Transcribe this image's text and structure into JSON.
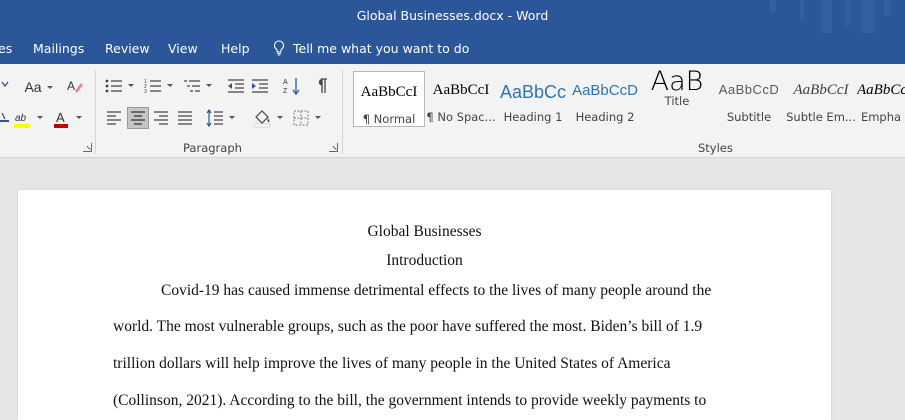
{
  "window": {
    "title": "Global Businesses.docx  -  Word"
  },
  "tabs": [
    "es",
    "Mailings",
    "Review",
    "View",
    "Help"
  ],
  "tell_me": "Tell me what you want to do",
  "ribbon": {
    "font_group": {
      "change_case_label": "Aa"
    },
    "paragraph_group": {
      "label": "Paragraph"
    },
    "styles_group": {
      "label": "Styles",
      "styles": [
        {
          "preview": "AaBbCcI",
          "name": "¶ Normal",
          "color": "#000000",
          "selected": true
        },
        {
          "preview": "AaBbCcI",
          "name": "¶ No Spac...",
          "color": "#000000"
        },
        {
          "preview": "AaBbCc",
          "name": "Heading 1",
          "color": "#2e74b5"
        },
        {
          "preview": "AaBbCcD",
          "name": "Heading 2",
          "color": "#2e74b5"
        },
        {
          "preview": "AaB",
          "name": "Title",
          "color": "#000000"
        },
        {
          "preview": "AaBbCcD",
          "name": "Subtitle",
          "color": "#595959"
        },
        {
          "preview": "AaBbCcI",
          "name": "Subtle Em...",
          "color": "#404040"
        },
        {
          "preview": "AaBbCcI",
          "name": "Empha",
          "color": "#000000"
        }
      ]
    },
    "colors": {
      "highlight": "#ffff00",
      "font_color": "#c00000"
    }
  },
  "document": {
    "title": "Global Businesses",
    "heading": "Introduction",
    "lines": [
      "Covid-19 has caused immense detrimental effects to the lives of many people around the",
      "world. The most vulnerable groups, such as the poor have suffered the most. Biden’s bill of 1.9",
      "trillion dollars will help improve the lives of many people in the United States of America",
      "(Collinson, 2021). According to the bill, the government intends to provide weekly payments to"
    ]
  },
  "theme": {
    "accent": "#2b579a",
    "ribbon_bg": "#f3f3f3",
    "canvas_bg": "#e6e6e6"
  }
}
